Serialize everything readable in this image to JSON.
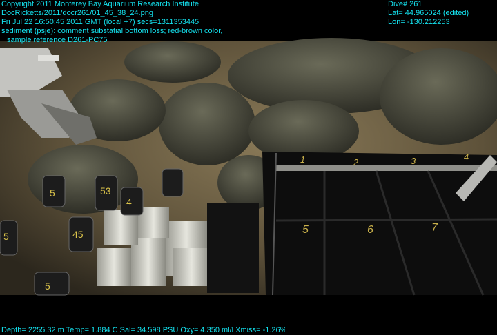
{
  "overlay": {
    "copyright": "Copyright 2011 Monterey Bay Aquarium Research Institute",
    "filename": "DocRicketts/2011/docr261/01_45_38_24.png",
    "datetime": "Fri Jul 22 16:50:45 2011 GMT (local +7)  secs=1311353445",
    "comment_line1": "sediment (psje): comment substatial bottom loss; red-brown color,",
    "comment_line2": "sample reference D261-PC75",
    "dive": "Dive# 261",
    "lat": "Lat= 44.965024 (edited)",
    "lon": "Lon= -130.212253",
    "telemetry": "Depth= 2255.32 m  Temp= 1.884 C  Sal= 34.598 PSU  Oxy= 4.350 ml/l  Xmiss= -1.26%"
  },
  "scene": {
    "core_tube_labels": [
      "5",
      "53",
      "4",
      "45",
      "5",
      "5"
    ],
    "rack_top_numbers": [
      "1",
      "2",
      "3",
      "4"
    ],
    "rack_bottom_numbers": [
      "5",
      "6",
      "7"
    ],
    "colors": {
      "overlay_text": "#14e2ef",
      "sediment": "#6e5f43",
      "rock": "#4a4a3c",
      "rack": "#0d0d0d",
      "rack_label": "#c9b04a"
    }
  }
}
